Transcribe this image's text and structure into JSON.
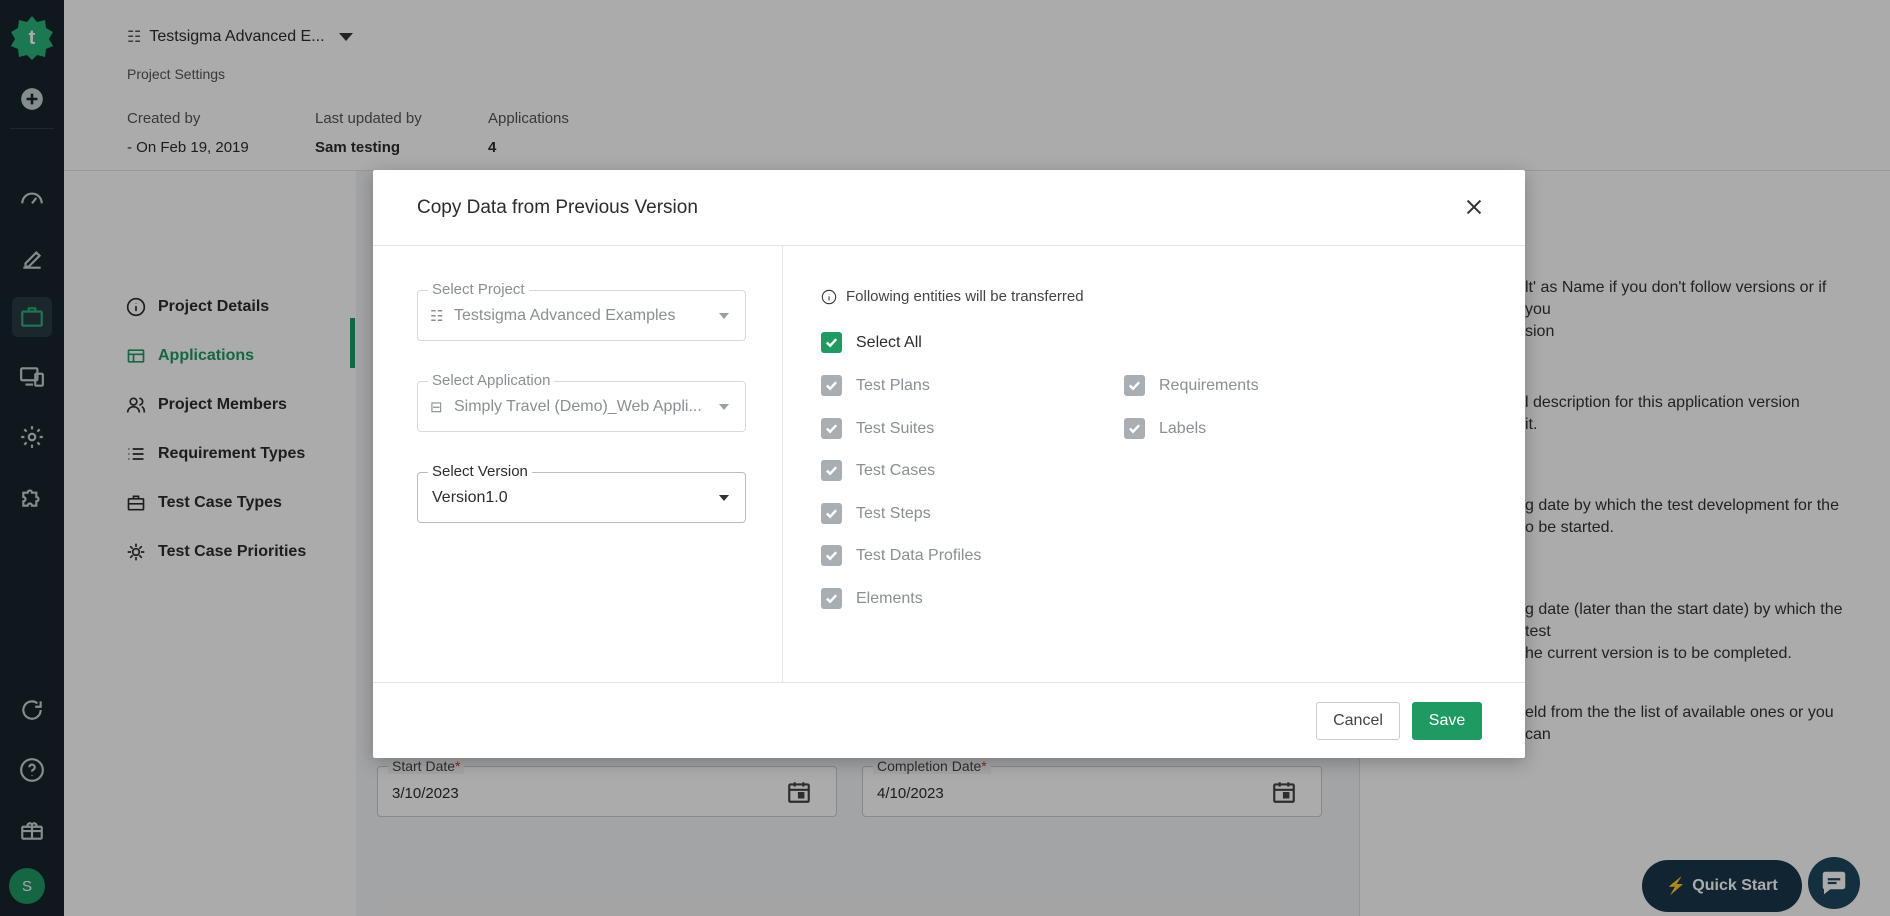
{
  "header": {
    "project_name": "Testsigma Advanced E...",
    "section_label": "Project Settings",
    "meta": [
      {
        "key": "Created by",
        "value": "- On Feb 19, 2019"
      },
      {
        "key": "Last updated by",
        "value": "Sam testing"
      },
      {
        "key": "Applications",
        "value": "4"
      }
    ]
  },
  "rail": {
    "icons": [
      "logo-icon",
      "add-icon",
      "dashboard-icon",
      "edit-icon",
      "briefcase-icon",
      "devices-icon",
      "settings-icon",
      "puzzle-icon",
      "refresh-icon",
      "help-icon",
      "gift-icon"
    ],
    "avatar_letter": "S"
  },
  "settings_nav": [
    {
      "label": "Project Details",
      "icon": "info-icon"
    },
    {
      "label": "Applications",
      "icon": "app-icon",
      "active": true
    },
    {
      "label": "Project Members",
      "icon": "users-icon"
    },
    {
      "label": "Requirement Types",
      "icon": "list-icon"
    },
    {
      "label": "Test Case Types",
      "icon": "briefcase-icon"
    },
    {
      "label": "Test Case Priorities",
      "icon": "gear-icon"
    }
  ],
  "help_text": [
    {
      "line1": "lt' as Name if you don't follow versions or if you",
      "line2": "sion"
    },
    {
      "line1": "l description for this application version",
      "line2": "it."
    },
    {
      "line1": "g date by which the test development for the",
      "line2": "o be started."
    },
    {
      "line1": "g date (later than the start date) by which the test",
      "line2": "he current version is to be completed."
    },
    {
      "line1": "eld from the the list of available ones or you can",
      "line2": ""
    }
  ],
  "dates": {
    "start_label": "Start Date",
    "start_value": "3/10/2023",
    "completion_label": "Completion Date",
    "completion_value": "4/10/2023",
    "required_mark": "*"
  },
  "quick_start_label": "Quick Start",
  "modal": {
    "title": "Copy Data from Previous Version",
    "project": {
      "label": "Select Project",
      "value": "Testsigma Advanced Examples"
    },
    "application": {
      "label": "Select Application",
      "value": "Simply Travel (Demo)_Web Appli..."
    },
    "version": {
      "label": "Select Version",
      "value": "Version1.0"
    },
    "info": "Following entities will be transferred",
    "select_all": "Select All",
    "entities_col1": [
      "Test Plans",
      "Test Suites",
      "Test Cases",
      "Test Steps",
      "Test Data Profiles",
      "Elements"
    ],
    "entities_col2": [
      "Requirements",
      "Labels"
    ],
    "cancel_label": "Cancel",
    "save_label": "Save"
  },
  "colors": {
    "brand_green": "#1f9a63",
    "rail_bg": "#17242b",
    "quick_start_bg": "#19364a"
  }
}
